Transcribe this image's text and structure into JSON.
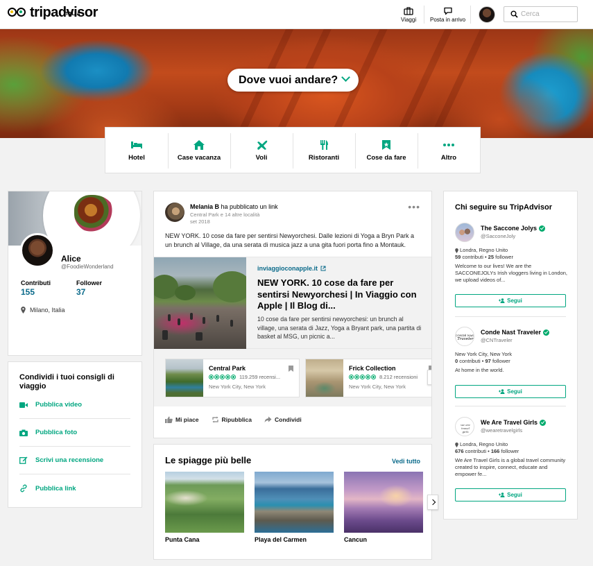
{
  "brand": {
    "name": "tripadvisor",
    "subtitle": "ITALIA",
    "accent": "#00a680",
    "link_color": "#0a6a8a"
  },
  "header": {
    "trips_label": "Viaggi",
    "inbox_label": "Posta in arrivo",
    "search_placeholder": "Cerca"
  },
  "hero": {
    "destination_prompt": "Dove vuoi andare?"
  },
  "categories": [
    {
      "label": "Hotel",
      "icon": "bed-icon"
    },
    {
      "label": "Case vacanza",
      "icon": "house-icon"
    },
    {
      "label": "Voli",
      "icon": "plane-icon"
    },
    {
      "label": "Ristoranti",
      "icon": "fork-knife-icon"
    },
    {
      "label": "Cose da fare",
      "icon": "attraction-icon"
    },
    {
      "label": "Altro",
      "icon": "more-dots-icon"
    }
  ],
  "profile": {
    "name": "Alice",
    "handle": "@FoodieWonderland",
    "contrib_label": "Contributi",
    "contrib_value": "155",
    "follower_label": "Follower",
    "follower_value": "37",
    "location": "Milano, Italia"
  },
  "share": {
    "title": "Condividi i tuoi consigli di viaggio",
    "items": [
      {
        "label": "Pubblica video",
        "icon": "video-icon"
      },
      {
        "label": "Pubblica foto",
        "icon": "camera-icon"
      },
      {
        "label": "Scrivi una recensione",
        "icon": "edit-icon"
      },
      {
        "label": "Pubblica link",
        "icon": "link-icon"
      }
    ]
  },
  "post": {
    "author": "Melania B",
    "action": "ha pubblicato un link",
    "places": "Central Park e 14 altre località",
    "date": "set 2018",
    "text": "NEW YORK. 10 cose da fare per sentirsi Newyorchesi. Dalle lezioni di Yoga a Bryn Park a un brunch al Village, da una serata di musica jazz a una gita fuori porta fino a Montauk.",
    "link": {
      "domain": "inviaggioconapple.it",
      "title": "NEW YORK. 10 cose da fare per sentirsi Newyorchesi | In Viaggio con Apple | Il Blog di...",
      "description": "10 cose da fare per sentirsi newyorchesi: un brunch al village, una serata di Jazz, Yoga a Bryant park, una partita di basket al MSG, un picnic a..."
    },
    "pois": [
      {
        "name": "Central Park",
        "reviews": "119.259 recensi...",
        "location": "New York City, New York"
      },
      {
        "name": "Frick Collection",
        "reviews": "8.212 recensioni",
        "location": "New York City, New York"
      }
    ],
    "actions": {
      "like": "Mi piace",
      "repost": "Ripubblica",
      "share": "Condividi"
    }
  },
  "beaches": {
    "title": "Le spiagge più belle",
    "see_all": "Vedi tutto",
    "items": [
      {
        "name": "Punta Cana"
      },
      {
        "name": "Playa del Carmen"
      },
      {
        "name": "Cancun"
      }
    ]
  },
  "follow": {
    "title": "Chi seguire su TripAdvisor",
    "button_label": "Segui",
    "people": [
      {
        "name": "The Saccone Jolys",
        "handle": "@SacconeJoly",
        "location": "Londra, Regno Unito",
        "contrib": "59",
        "contrib_label": "contributi",
        "followers": "25",
        "followers_label": "follower",
        "desc": "Welcome to our lives! We are the SACCONEJOLYs Irish vloggers living in London, we upload videos of..."
      },
      {
        "name": "Conde Nast Traveler",
        "handle": "@CNTraveler",
        "location": "New York City, New York",
        "contrib": "0",
        "contrib_label": "contributi",
        "followers": "97",
        "followers_label": "follower",
        "desc": "At home in the world."
      },
      {
        "name": "We Are Travel Girls",
        "handle": "@wearetravelgirls",
        "location": "Londra, Regno Unito",
        "contrib": "676",
        "contrib_label": "contributi",
        "followers": "166",
        "followers_label": "follower",
        "desc": "We Are Travel Girls is a global travel community created to inspire, connect, educate and empower fe..."
      }
    ]
  }
}
